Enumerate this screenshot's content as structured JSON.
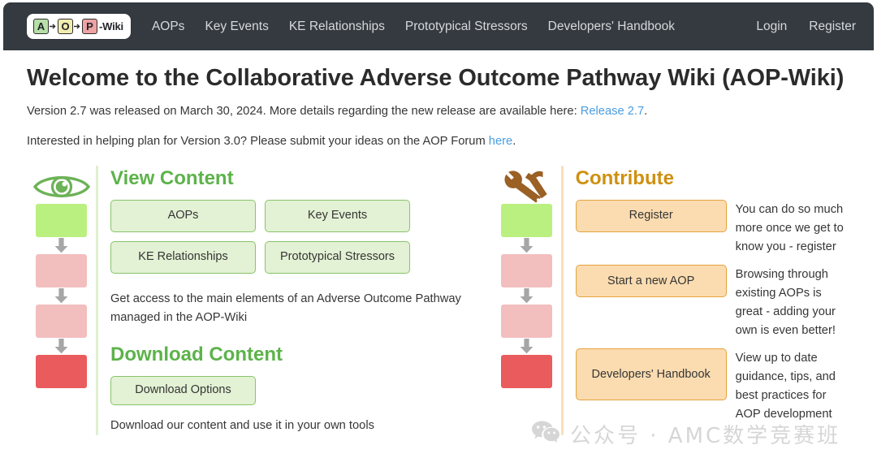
{
  "navbar": {
    "brand": {
      "boxes": [
        {
          "letter": "A",
          "color": "#b7dfa8"
        },
        {
          "letter": "O",
          "color": "#f3ecb0"
        },
        {
          "letter": "P",
          "color": "#eda3a3"
        }
      ],
      "suffix": "-Wiki"
    },
    "links": [
      {
        "label": "AOPs"
      },
      {
        "label": "Key Events"
      },
      {
        "label": "KE Relationships"
      },
      {
        "label": "Prototypical Stressors"
      },
      {
        "label": "Developers' Handbook"
      }
    ],
    "right_links": [
      {
        "label": "Login"
      },
      {
        "label": "Register"
      }
    ]
  },
  "main": {
    "title": "Welcome to the Collaborative Adverse Outcome Pathway Wiki (AOP-Wiki)",
    "intro_1": {
      "before": "Version 2.7 was released on March 30, 2024. More details regarding the new release are available here: ",
      "link": "Release 2.7",
      "after": "."
    },
    "intro_2": {
      "before": "Interested in helping plan for Version 3.0? Please submit your ideas on the AOP Forum ",
      "link": "here",
      "after": "."
    }
  },
  "view_content": {
    "icon": "eye-icon",
    "accent": "#5cb34a",
    "title": "View Content",
    "buttons": [
      {
        "label": "AOPs"
      },
      {
        "label": "Key Events"
      },
      {
        "label": "KE Relationships"
      },
      {
        "label": "Prototypical Stressors"
      }
    ],
    "description": "Get access to the main elements of an Adverse Outcome Pathway managed in the AOP-Wiki",
    "download_title": "Download Content",
    "download_button": "Download Options",
    "download_description": "Download our content and use it in your own tools"
  },
  "contribute": {
    "icon": "tools-icon",
    "accent": "#cf9011",
    "title": "Contribute",
    "rows": [
      {
        "button": "Register",
        "description": "You can do so much more once we get to know you - register"
      },
      {
        "button": "Start a new AOP",
        "description": "Browsing through existing AOPs is great - adding your own is even better!"
      },
      {
        "button": "Developers' Handbook",
        "description": "View up to date guidance, tips, and best practices for AOP development"
      }
    ]
  },
  "flowchart": {
    "boxes": [
      {
        "color": "#baf07f"
      },
      {
        "color": "#f3bebe"
      },
      {
        "color": "#f3bebe"
      },
      {
        "color": "#ea5b5d"
      }
    ]
  },
  "watermark": {
    "icon": "wechat-icon",
    "text": "公众号 · AMC数学竞赛班"
  }
}
